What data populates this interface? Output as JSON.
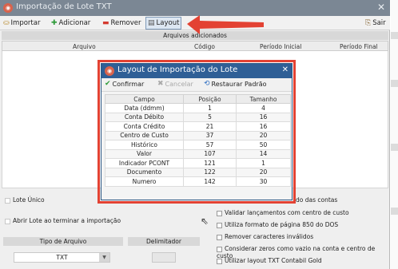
{
  "window": {
    "title": "Importação de Lote TXT",
    "close_glyph": "✕"
  },
  "toolbar": {
    "import_label": "Importar",
    "add_label": "Adicionar",
    "remove_label": "Remover",
    "layout_label": "Layout",
    "exit_label": "Sair"
  },
  "files_section": {
    "title": "Arquivos adicionados",
    "columns": [
      "Arquivo",
      "Código",
      "Período Inicial",
      "Período Final"
    ]
  },
  "options_left": {
    "lote_unico": "Lote Único",
    "abrir_lote": "Abrir Lote ao terminar a importação"
  },
  "file_type": {
    "label": "Tipo de Arquivo",
    "value": "TXT"
  },
  "delimiter": {
    "label": "Delimitador"
  },
  "options_right": [
    "do das contas",
    "Validar lançamentos com centro de custo",
    "Utiliza formato de página 850 do DOS",
    "Remover caracteres inválidos",
    "Considerar zeros como vazio na conta e centro de custo",
    "Utilizar layout TXT Contabil Gold"
  ],
  "layout_dialog": {
    "title": "Layout de Importação do Lote",
    "close_glyph": "✕",
    "confirm_label": "Confirmar",
    "cancel_label": "Cancelar",
    "restore_label": "Restaurar Padrão",
    "headers": [
      "Campo",
      "Posição",
      "Tamanho"
    ],
    "rows": [
      [
        "Data (ddmm)",
        "1",
        "4"
      ],
      [
        "Conta Débito",
        "5",
        "16"
      ],
      [
        "Conta Crédito",
        "21",
        "16"
      ],
      [
        "Centro de Custo",
        "37",
        "20"
      ],
      [
        "Histórico",
        "57",
        "50"
      ],
      [
        "Valor",
        "107",
        "14"
      ],
      [
        "Indicador PCONT",
        "121",
        "1"
      ],
      [
        "Documento",
        "122",
        "20"
      ],
      [
        "Numero",
        "142",
        "30"
      ]
    ]
  },
  "colors": {
    "highlight_red": "#e34233",
    "dialog_titlebar": "#2f5f96",
    "window_titlebar": "#7b8794"
  }
}
